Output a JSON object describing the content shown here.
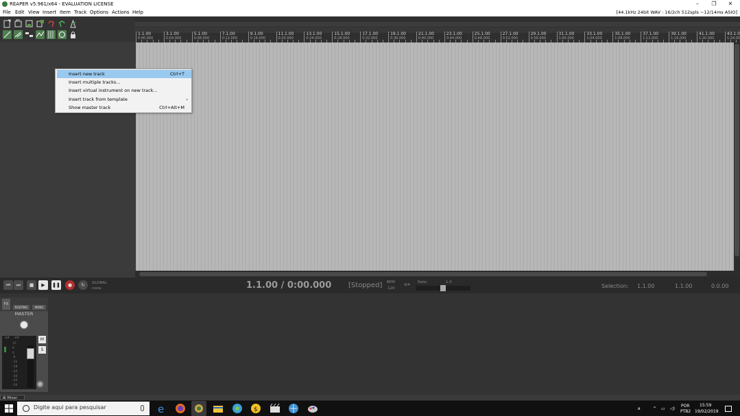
{
  "window": {
    "title": "REAPER v5.961/x64 - EVALUATION LICENSE",
    "minimize": "–",
    "maximize": "❐",
    "close": "✕"
  },
  "menubar": {
    "items": [
      "File",
      "Edit",
      "View",
      "Insert",
      "Item",
      "Track",
      "Options",
      "Actions",
      "Help"
    ],
    "audio_status": "[44.1kHz 24bit WAV : 16/2ch 512spls ~12/14ms ASIO]"
  },
  "ruler": {
    "markers": [
      {
        "bar": "1.1.00",
        "time": "0:00.000"
      },
      {
        "bar": "3.1.00",
        "time": "0:04.000"
      },
      {
        "bar": "5.1.00",
        "time": "0:08.000"
      },
      {
        "bar": "7.1.00",
        "time": "0:12.000"
      },
      {
        "bar": "9.1.00",
        "time": "0:16.000"
      },
      {
        "bar": "11.1.00",
        "time": "0:20.000"
      },
      {
        "bar": "13.1.00",
        "time": "0:24.000"
      },
      {
        "bar": "15.1.00",
        "time": "0:28.000"
      },
      {
        "bar": "17.1.00",
        "time": "0:32.000"
      },
      {
        "bar": "19.1.00",
        "time": "0:36.000"
      },
      {
        "bar": "21.1.00",
        "time": "0:40.000"
      },
      {
        "bar": "23.1.00",
        "time": "0:44.000"
      },
      {
        "bar": "25.1.00",
        "time": "0:48.000"
      },
      {
        "bar": "27.1.00",
        "time": "0:52.000"
      },
      {
        "bar": "29.1.00",
        "time": "0:56.000"
      },
      {
        "bar": "31.1.00",
        "time": "1:00.000"
      },
      {
        "bar": "33.1.00",
        "time": "1:04.000"
      },
      {
        "bar": "35.1.00",
        "time": "1:08.000"
      },
      {
        "bar": "37.1.00",
        "time": "1:12.000"
      },
      {
        "bar": "39.1.00",
        "time": "1:16.000"
      },
      {
        "bar": "41.1.00",
        "time": "1:20.000"
      },
      {
        "bar": "43.1.00",
        "time": "1:24.000"
      }
    ]
  },
  "context_menu": {
    "items": [
      {
        "label": "Insert new track",
        "shortcut": "Ctrl+T",
        "active": true
      },
      {
        "label": "Insert multiple tracks...",
        "shortcut": ""
      },
      {
        "label": "Insert virtual instrument on new track...",
        "shortcut": ""
      },
      {
        "label": "Insert track from template",
        "shortcut": "›"
      },
      {
        "label": "Show master track",
        "shortcut": "Ctrl+Alt+M"
      }
    ]
  },
  "transport": {
    "time": "1.1.00 / 0:00.000",
    "state": "[Stopped]",
    "bpm_label": "BPM",
    "bpm": "120",
    "time_sig": "4/4",
    "rate_label": "Rate:",
    "rate": "1.0",
    "global_label": "GLOBAL",
    "none_label": "none",
    "selection_label": "Selection:",
    "sel_start": "1.1.00",
    "sel_end": "1.1.00",
    "sel_length": "0.0.00"
  },
  "mixer": {
    "master_name": "MASTER",
    "routing_label": "ROUTING",
    "mono_label": "MONO",
    "fx_label": "FX",
    "mute": "M",
    "solo": "S",
    "meter_inf_left": "-inf",
    "meter_inf_right": "-inf",
    "scale": [
      "12",
      "6",
      "0",
      "-6",
      "-12",
      "-18",
      "-24",
      "-30",
      "-42",
      "-54"
    ],
    "tab_label": "Mixer"
  },
  "taskbar": {
    "search_placeholder": "Digite aqui para pesquisar",
    "lang1": "POR",
    "lang2": "PTB2",
    "time": "15:59",
    "date": "19/02/2019"
  }
}
